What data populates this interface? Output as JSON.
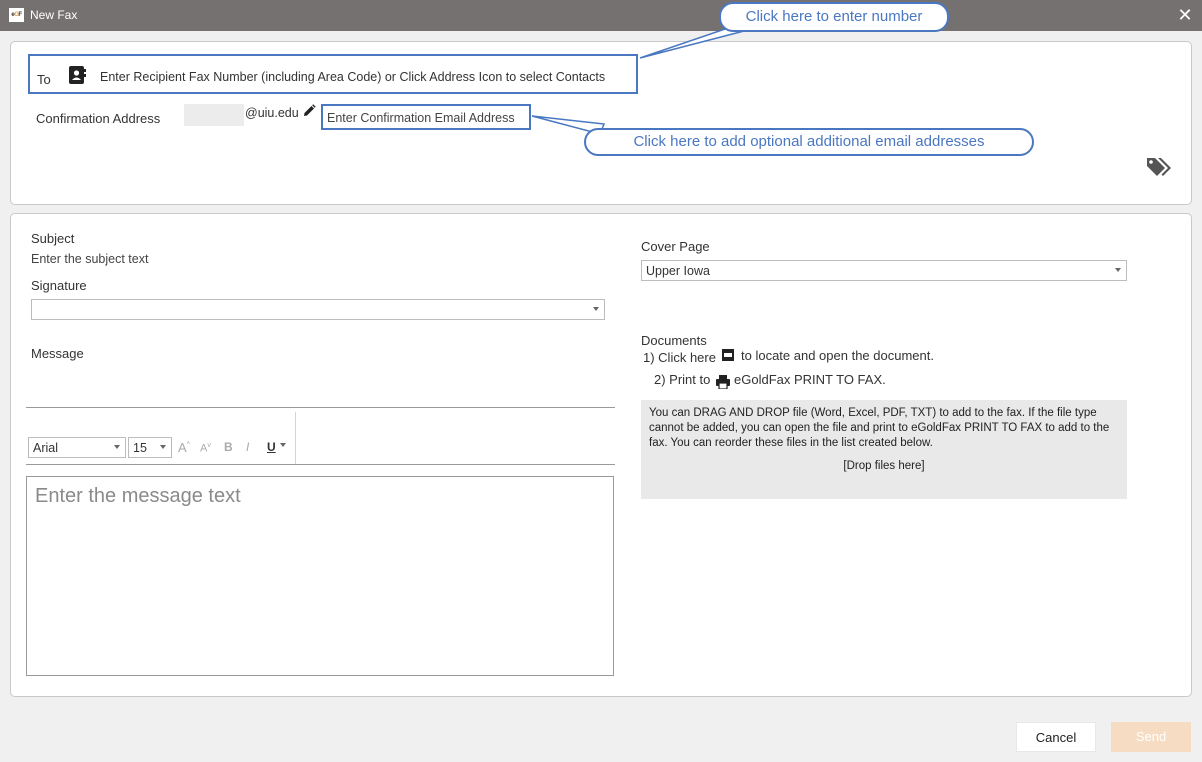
{
  "window": {
    "title": "New Fax",
    "logo_text_left": "e",
    "logo_text_o": "G",
    "logo_text_right": "F"
  },
  "to": {
    "label": "To",
    "placeholder": "Enter Recipient Fax Number (including Area Code) or Click Address Icon to select Contacts"
  },
  "confirmation": {
    "label": "Confirmation Address",
    "domain": "@uiu.edu",
    "placeholder": "Enter Confirmation Email Address"
  },
  "callouts": {
    "number": "Click here to enter number",
    "email": "Click here to add optional additional email addresses"
  },
  "subject": {
    "label": "Subject",
    "placeholder": "Enter the subject text"
  },
  "signature": {
    "label": "Signature",
    "value": ""
  },
  "message": {
    "label": "Message",
    "placeholder": "Enter the message text"
  },
  "editor": {
    "font": "Arial",
    "size": "15",
    "grow": "A",
    "shrink": "A",
    "bold": "B",
    "italic": "I",
    "underline": "U"
  },
  "cover_page": {
    "label": "Cover Page",
    "value": "Upper Iowa"
  },
  "documents": {
    "label": "Documents",
    "step1_prefix": "1) Click here",
    "step1_suffix": "to locate and open the document.",
    "step2_prefix": "2) Print to",
    "step2_suffix": "eGoldFax PRINT TO FAX.",
    "drop_instructions": "You can DRAG AND DROP file (Word, Excel, PDF, TXT) to add to the fax. If the file type cannot be added, you can open the file and print to eGoldFax PRINT TO FAX to add to the fax. You can reorder these files in the list created below.",
    "drop_here": "[Drop files here]"
  },
  "buttons": {
    "cancel": "Cancel",
    "send": "Send"
  },
  "colors": {
    "titlebar": "#767171",
    "callout_border": "#4a77c1",
    "send_disabled": "#f7dcc4"
  }
}
